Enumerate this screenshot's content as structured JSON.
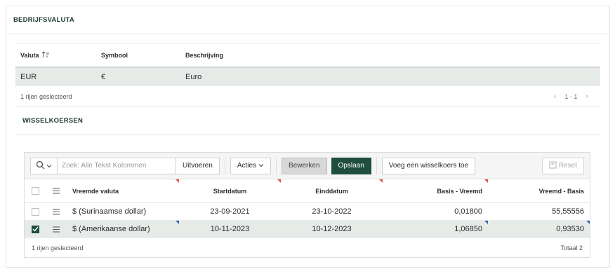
{
  "bedrijfsvaluta": {
    "title": "BEDRIJFSVALUTA",
    "columns": {
      "valuta": "Valuta",
      "symbool": "Symbool",
      "beschrijving": "Beschrijving"
    },
    "row": {
      "valuta": "EUR",
      "symbool": "€",
      "beschrijving": "Euro"
    },
    "footer_selected": "1 rijen geslecteerd",
    "pagination": "1 - 1"
  },
  "wisselkoersen": {
    "title": "WISSELKOERSEN",
    "toolbar": {
      "search_placeholder": "Zoek: Alle Tekst Kolommen",
      "uitvoeren": "Uitvoeren",
      "acties": "Acties",
      "bewerken": "Bewerken",
      "opslaan": "Opslaan",
      "voeg_toe": "Voeg een wisselkoers toe",
      "reset": "Reset"
    },
    "columns": {
      "vreemde_valuta": "Vreemde valuta",
      "startdatum": "Startdatum",
      "einddatum": "Einddatum",
      "basis_vreemd": "Basis - Vreemd",
      "vreemd_basis": "Vreemd - Basis"
    },
    "rows": [
      {
        "vreemde_valuta": "$ (Surinaamse dollar)",
        "startdatum": "23-09-2021",
        "einddatum": "23-10-2022",
        "basis_vreemd": "0,01800",
        "vreemd_basis": "55,55556",
        "selected": false
      },
      {
        "vreemde_valuta": "$ (Amerikaanse dollar)",
        "startdatum": "10-11-2023",
        "einddatum": "10-12-2023",
        "basis_vreemd": "1,06850",
        "vreemd_basis": "0,93530",
        "selected": true
      }
    ],
    "footer_selected": "1 rijen geslecteerd",
    "footer_total": "Totaal 2"
  },
  "colors": {
    "accent": "#1f4d3e",
    "selected_row": "#e6ebe8",
    "changed_marker": "#d9534f",
    "edited_marker": "#2a66c9"
  },
  "icons": [
    "sort-ascending-icon",
    "search-icon",
    "chevron-down-icon",
    "chevron-left-icon",
    "chevron-right-icon",
    "row-menu-icon",
    "checkbox-icon",
    "reset-icon"
  ]
}
